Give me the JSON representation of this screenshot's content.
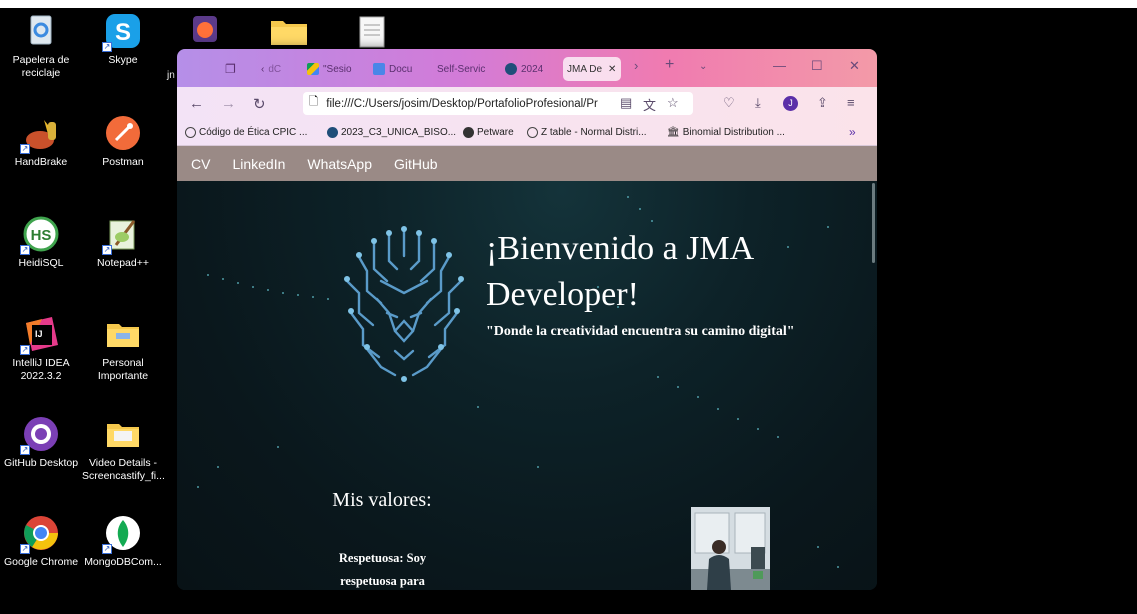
{
  "desktop": {
    "icons": [
      {
        "label": "Papelera de reciclaje",
        "icon": "recycle-bin-icon"
      },
      {
        "label": "Skype",
        "icon": "skype-icon"
      },
      {
        "label": "HandBrake",
        "icon": "handbrake-icon"
      },
      {
        "label": "Postman",
        "icon": "postman-icon"
      },
      {
        "label": "HeidiSQL",
        "icon": "heidisql-icon"
      },
      {
        "label": "Notepad++",
        "icon": "notepadpp-icon"
      },
      {
        "label": "IntelliJ IDEA 2022.3.2",
        "icon": "intellij-icon"
      },
      {
        "label": "Personal Importante",
        "icon": "folder-icon"
      },
      {
        "label": "GitHub Desktop",
        "icon": "github-desktop-icon"
      },
      {
        "label": "Video Details - Screencastify_fi...",
        "icon": "folder-icon"
      },
      {
        "label": "Google Chrome",
        "icon": "chrome-icon"
      },
      {
        "label": "MongoDBCom...",
        "icon": "mongodb-icon"
      }
    ],
    "clipped_label": "jn"
  },
  "browser": {
    "tabs": [
      {
        "label": "",
        "icon": "tab-overview-icon"
      },
      {
        "label": "dC",
        "icon": "back-chevron-icon"
      },
      {
        "label": "\"Sesio",
        "icon": "google-drive-icon"
      },
      {
        "label": "Docu",
        "icon": "google-docs-icon"
      },
      {
        "label": "Self-Servic",
        "icon": ""
      },
      {
        "label": "2024",
        "icon": "globe-icon"
      },
      {
        "label": "JMA De",
        "icon": "",
        "active": true
      }
    ],
    "url": "file:///C:/Users/josim/Desktop/PortafolioProfesional/Pr",
    "bookmarks": [
      {
        "label": "Código de Ética CPIC ...",
        "icon": "globe-icon"
      },
      {
        "label": "2023_C3_UNICA_BISO...",
        "icon": "globe-icon"
      },
      {
        "label": "Petware",
        "icon": "angular-icon"
      },
      {
        "label": "Z table - Normal Distri...",
        "icon": "globe-icon"
      },
      {
        "label": "Binomial Distribution ...",
        "icon": "bank-icon"
      }
    ],
    "profile_initial": "J"
  },
  "site": {
    "nav": [
      "CV",
      "LinkedIn",
      "WhatsApp",
      "GitHub"
    ],
    "title": "¡Bienvenido a JMA Developer!",
    "tagline": "\"Donde la creatividad encuentra su camino digital\"",
    "values_title": "Mis valores:",
    "values_text": "Respetuosa: Soy respetuosa para"
  }
}
